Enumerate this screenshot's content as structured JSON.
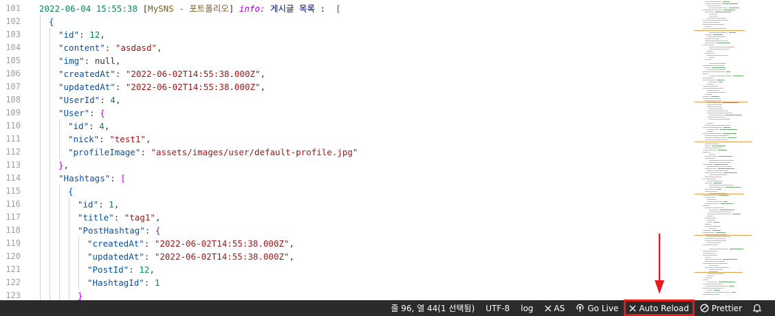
{
  "editor": {
    "lines": [
      {
        "n": "101",
        "segs": [
          [
            "tok-date",
            "2022-06-04 15:55:38 "
          ],
          [
            "tok-plain",
            "["
          ],
          [
            "tok-title",
            "MySNS - 포트폴리오"
          ],
          [
            "tok-plain",
            "] "
          ],
          [
            "tok-info",
            "info:"
          ],
          [
            "tok-kor",
            " 게시글 목록 :  "
          ],
          [
            "tok-bracket",
            "["
          ]
        ],
        "guides": 0
      },
      {
        "n": "102",
        "segs": [
          [
            "tok-bracket2",
            "{"
          ]
        ],
        "guides": 1
      },
      {
        "n": "103",
        "segs": [
          [
            "tok-key",
            "\"id\""
          ],
          [
            "tok-plain",
            ": "
          ],
          [
            "tok-num",
            "12"
          ],
          [
            "tok-plain",
            ","
          ]
        ],
        "guides": 2
      },
      {
        "n": "104",
        "segs": [
          [
            "tok-key",
            "\"content\""
          ],
          [
            "tok-plain",
            ": "
          ],
          [
            "tok-str",
            "\"asdasd\""
          ],
          [
            "tok-plain",
            ","
          ]
        ],
        "guides": 2
      },
      {
        "n": "105",
        "segs": [
          [
            "tok-key",
            "\"img\""
          ],
          [
            "tok-plain",
            ": "
          ],
          [
            "tok-null",
            "null"
          ],
          [
            "tok-plain",
            ","
          ]
        ],
        "guides": 2
      },
      {
        "n": "106",
        "segs": [
          [
            "tok-key",
            "\"createdAt\""
          ],
          [
            "tok-plain",
            ": "
          ],
          [
            "tok-str",
            "\"2022-06-02T14:55:38.000Z\""
          ],
          [
            "tok-plain",
            ","
          ]
        ],
        "guides": 2
      },
      {
        "n": "107",
        "segs": [
          [
            "tok-key",
            "\"updatedAt\""
          ],
          [
            "tok-plain",
            ": "
          ],
          [
            "tok-str",
            "\"2022-06-02T14:55:38.000Z\""
          ],
          [
            "tok-plain",
            ","
          ]
        ],
        "guides": 2
      },
      {
        "n": "108",
        "segs": [
          [
            "tok-key",
            "\"UserId\""
          ],
          [
            "tok-plain",
            ": "
          ],
          [
            "tok-num",
            "4"
          ],
          [
            "tok-plain",
            ","
          ]
        ],
        "guides": 2
      },
      {
        "n": "109",
        "segs": [
          [
            "tok-key",
            "\"User\""
          ],
          [
            "tok-plain",
            ": "
          ],
          [
            "tok-bracket",
            "{"
          ]
        ],
        "guides": 2
      },
      {
        "n": "110",
        "segs": [
          [
            "tok-key",
            "\"id\""
          ],
          [
            "tok-plain",
            ": "
          ],
          [
            "tok-num",
            "4"
          ],
          [
            "tok-plain",
            ","
          ]
        ],
        "guides": 3
      },
      {
        "n": "111",
        "segs": [
          [
            "tok-key",
            "\"nick\""
          ],
          [
            "tok-plain",
            ": "
          ],
          [
            "tok-str",
            "\"test1\""
          ],
          [
            "tok-plain",
            ","
          ]
        ],
        "guides": 3
      },
      {
        "n": "112",
        "segs": [
          [
            "tok-key",
            "\"profileImage\""
          ],
          [
            "tok-plain",
            ": "
          ],
          [
            "tok-str",
            "\"assets/images/user/default-profile.jpg\""
          ]
        ],
        "guides": 3
      },
      {
        "n": "113",
        "segs": [
          [
            "tok-bracket",
            "}"
          ],
          [
            "tok-plain",
            ","
          ]
        ],
        "guides": 2
      },
      {
        "n": "114",
        "segs": [
          [
            "tok-key",
            "\"Hashtags\""
          ],
          [
            "tok-plain",
            ": "
          ],
          [
            "tok-bracket",
            "["
          ]
        ],
        "guides": 2
      },
      {
        "n": "115",
        "segs": [
          [
            "tok-bracket2",
            "{"
          ]
        ],
        "guides": 3
      },
      {
        "n": "116",
        "segs": [
          [
            "tok-key",
            "\"id\""
          ],
          [
            "tok-plain",
            ": "
          ],
          [
            "tok-num",
            "1"
          ],
          [
            "tok-plain",
            ","
          ]
        ],
        "guides": 4
      },
      {
        "n": "117",
        "segs": [
          [
            "tok-key",
            "\"title\""
          ],
          [
            "tok-plain",
            ": "
          ],
          [
            "tok-str",
            "\"tag1\""
          ],
          [
            "tok-plain",
            ","
          ]
        ],
        "guides": 4
      },
      {
        "n": "118",
        "segs": [
          [
            "tok-key",
            "\"PostHashtag\""
          ],
          [
            "tok-plain",
            ": "
          ],
          [
            "tok-bracket",
            "{"
          ]
        ],
        "guides": 4
      },
      {
        "n": "119",
        "segs": [
          [
            "tok-key",
            "\"createdAt\""
          ],
          [
            "tok-plain",
            ": "
          ],
          [
            "tok-str",
            "\"2022-06-02T14:55:38.000Z\""
          ],
          [
            "tok-plain",
            ","
          ]
        ],
        "guides": 5
      },
      {
        "n": "120",
        "segs": [
          [
            "tok-key",
            "\"updatedAt\""
          ],
          [
            "tok-plain",
            ": "
          ],
          [
            "tok-str",
            "\"2022-06-02T14:55:38.000Z\""
          ],
          [
            "tok-plain",
            ","
          ]
        ],
        "guides": 5
      },
      {
        "n": "121",
        "segs": [
          [
            "tok-key",
            "\"PostId\""
          ],
          [
            "tok-plain",
            ": "
          ],
          [
            "tok-num",
            "12"
          ],
          [
            "tok-plain",
            ","
          ]
        ],
        "guides": 5
      },
      {
        "n": "122",
        "segs": [
          [
            "tok-key",
            "\"HashtagId\""
          ],
          [
            "tok-plain",
            ": "
          ],
          [
            "tok-num",
            "1"
          ]
        ],
        "guides": 5
      },
      {
        "n": "123",
        "segs": [
          [
            "tok-bracket",
            "}"
          ]
        ],
        "guides": 4
      }
    ]
  },
  "statusbar": {
    "cursor_position": "줄 96, 열 44(1 선택됨)",
    "encoding": "UTF-8",
    "language": "log",
    "as_label": "AS",
    "go_live_label": "Go Live",
    "auto_reload_label": "Auto Reload",
    "prettier_label": "Prettier",
    "highlight_color": "#e21b1b",
    "background_color": "#2b2b2b"
  }
}
